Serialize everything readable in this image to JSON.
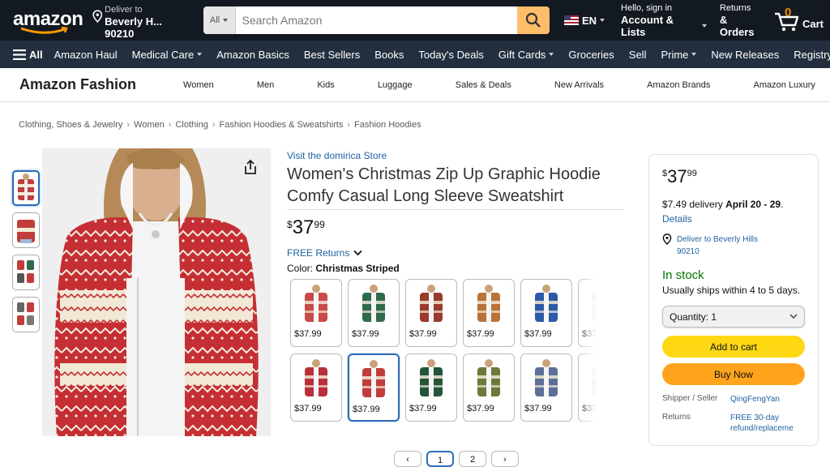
{
  "header": {
    "logo": "amazon",
    "deliver_line1": "Deliver to",
    "deliver_line2": "Beverly H... 90210",
    "search_category": "All",
    "search_placeholder": "Search Amazon",
    "language": "EN",
    "account_line1": "Hello, sign in",
    "account_line2": "Account & Lists",
    "orders_line1": "Returns",
    "orders_line2": "& Orders",
    "cart_count": "0",
    "cart_label": "Cart"
  },
  "subnav": {
    "all_label": "All",
    "items": [
      "Amazon Haul",
      "Medical Care",
      "Amazon Basics",
      "Best Sellers",
      "Books",
      "Today's Deals",
      "Gift Cards",
      "Groceries",
      "Sell",
      "Prime",
      "New Releases",
      "Registry"
    ]
  },
  "fashion": {
    "brand": "Amazon Fashion",
    "items": [
      "Women",
      "Men",
      "Kids",
      "Luggage",
      "Sales & Deals",
      "New Arrivals",
      "Amazon Brands",
      "Amazon Luxury"
    ]
  },
  "breadcrumb": [
    "Clothing, Shoes & Jewelry",
    "Women",
    "Clothing",
    "Fashion Hoodies & Sweatshirts",
    "Fashion Hoodies"
  ],
  "product": {
    "store_link": "Visit the domirica Store",
    "title": "Women's Christmas Zip Up Graphic Hoodie Comfy Casual Long Sleeve Sweatshirt",
    "price_symbol": "$",
    "price_whole": "37",
    "price_fraction": "99",
    "returns_label": "FREE Returns",
    "color_label": "Color:",
    "color_value": "Christmas Striped",
    "swatch_price": "$37.99",
    "swatches": [
      {
        "price": "$37.99",
        "color": "#c94a4a"
      },
      {
        "price": "$37.99",
        "color": "#2f6b4a"
      },
      {
        "price": "$37.99",
        "color": "#9a3b2b"
      },
      {
        "price": "$37.99",
        "color": "#b8733a"
      },
      {
        "price": "$37.99",
        "color": "#2b5aa8"
      },
      {
        "price": "$37.",
        "color": "#bbbbbb"
      },
      {
        "price": "$37.99",
        "color": "#b8303a"
      },
      {
        "price": "$37.99",
        "color": "#c23c3c"
      },
      {
        "price": "$37.99",
        "color": "#23553b"
      },
      {
        "price": "$37.99",
        "color": "#6b7a3a"
      },
      {
        "price": "$37.99",
        "color": "#5b6f99"
      },
      {
        "price": "$37.",
        "color": "#bbbbbb"
      }
    ],
    "selected_swatch_index": 7,
    "pages": [
      "1",
      "2"
    ]
  },
  "buybox": {
    "price_symbol": "$",
    "price_whole": "37",
    "price_fraction": "99",
    "delivery_prefix": "$7.49 delivery",
    "delivery_dates": "April 20 - 29",
    "delivery_suffix": ".",
    "details_link": "Details",
    "deliver_to": "Deliver to Beverly Hills 90210",
    "stock": "In stock",
    "ships": "Usually ships within 4 to 5 days.",
    "quantity_label": "Quantity:",
    "quantity_value": "1",
    "add_to_cart": "Add to cart",
    "buy_now": "Buy Now",
    "shipper_key": "Shipper / Seller",
    "shipper_value": "QingFengYan",
    "returns_key": "Returns",
    "returns_value": "FREE 30-day refund/replaceme"
  },
  "colors": {
    "topnav": "#131921",
    "subnav": "#232f3e",
    "link": "#2162a1",
    "add_to_cart": "#ffd814",
    "buy_now": "#ffa41c",
    "in_stock": "#007600"
  }
}
